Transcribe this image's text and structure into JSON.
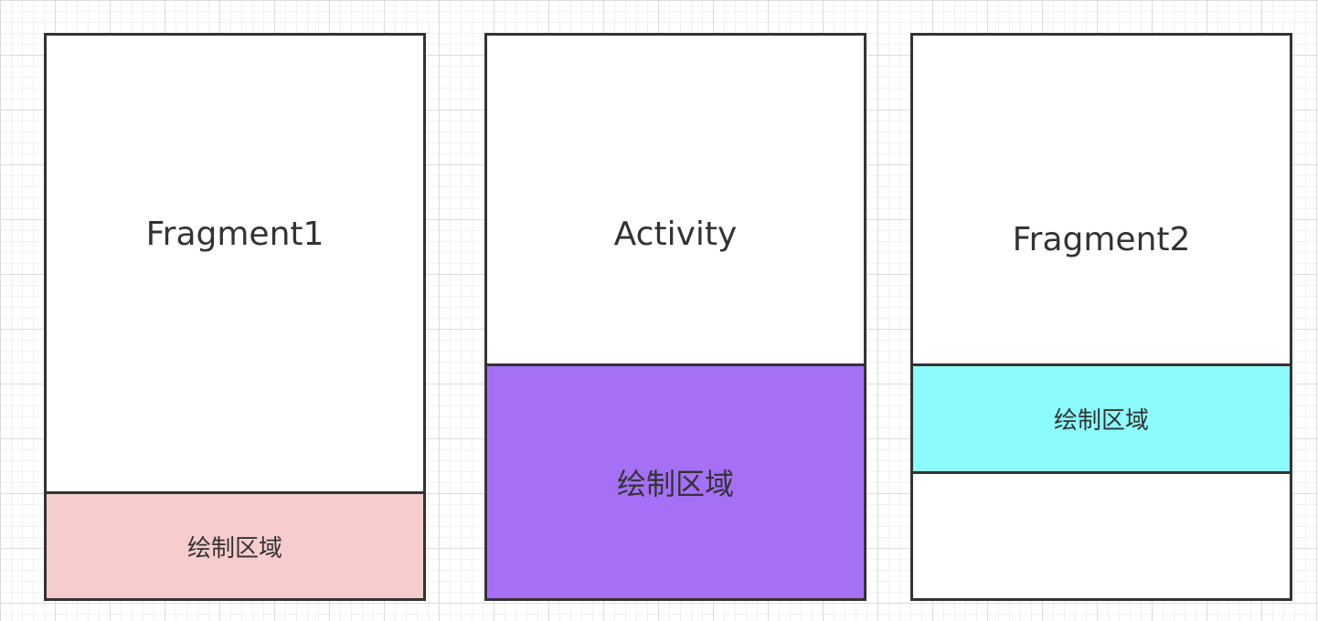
{
  "panels": [
    {
      "title": "Fragment1",
      "region_label": "绘制区域",
      "region_color": "#f6cccc"
    },
    {
      "title": "Activity",
      "region_label": "绘制区域",
      "region_color": "#a570f6"
    },
    {
      "title": "Fragment2",
      "region_label": "绘制区域",
      "region_color": "#8cfbfb"
    }
  ]
}
